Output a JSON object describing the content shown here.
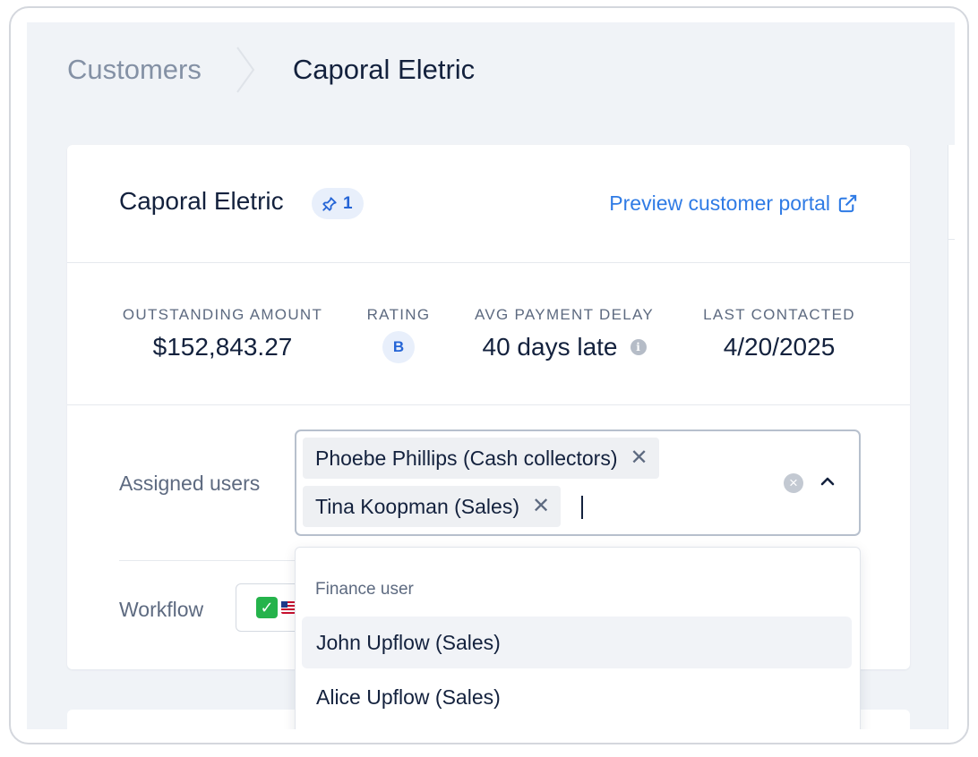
{
  "breadcrumb": {
    "parent": "Customers",
    "current": "Caporal Eletric"
  },
  "customer": {
    "name": "Caporal Eletric",
    "pin_count": "1",
    "portal_link": "Preview customer portal"
  },
  "stats": [
    {
      "label": "OUTSTANDING AMOUNT",
      "value": "$152,843.27"
    },
    {
      "label": "RATING",
      "value": "B"
    },
    {
      "label": "AVG PAYMENT DELAY",
      "value": "40 days late"
    },
    {
      "label": "LAST CONTACTED",
      "value": "4/20/2025"
    }
  ],
  "assigned_users": {
    "label": "Assigned users",
    "chips": [
      "Phoebe Phillips (Cash collectors)",
      "Tina Koopman (Sales)"
    ],
    "remove_glyph": "✕",
    "clear_glyph": "×"
  },
  "workflow": {
    "label": "Workflow"
  },
  "dropdown": {
    "group_label": "Finance user",
    "options": [
      "John Upflow (Sales)",
      "Alice Upflow (Sales)"
    ]
  },
  "colors": {
    "accent": "#2f7be5",
    "badge_bg": "#e8effb",
    "background": "#f0f3f7",
    "success": "#25b34b"
  }
}
